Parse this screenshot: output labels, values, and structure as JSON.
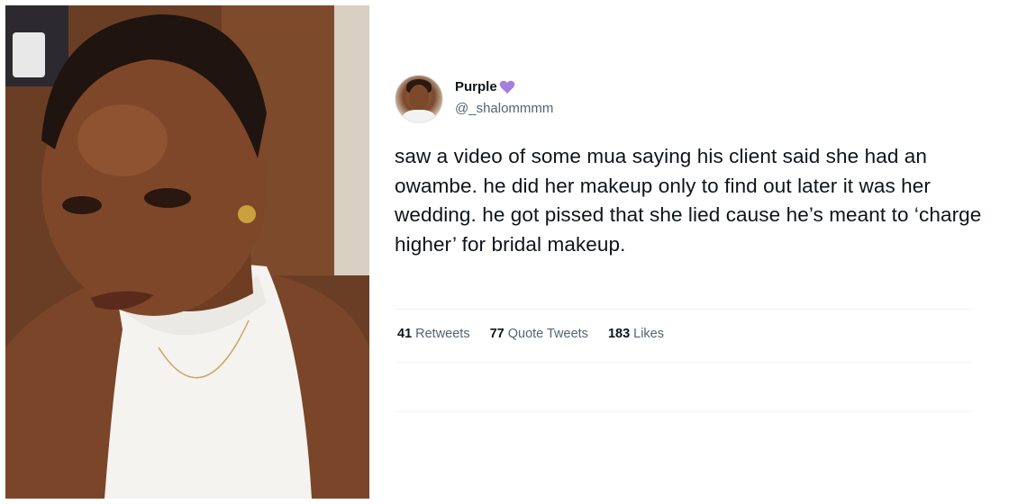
{
  "photo": {
    "alt_subject": "selfie-portrait"
  },
  "tweet": {
    "display_name": "Purple",
    "verified_emoji_icon": "purple-heart-icon",
    "handle": "@_shalommmm",
    "text": "saw a video of some mua saying his client said she had an owambe. he did her makeup only to find out later it was her wedding. he got pissed that she lied cause he’s meant to ‘charge higher’ for bridal makeup.",
    "stats": [
      {
        "count": "41",
        "label": "Retweets"
      },
      {
        "count": "77",
        "label": "Quote Tweets"
      },
      {
        "count": "183",
        "label": "Likes"
      }
    ]
  },
  "colors": {
    "text_primary": "#0f1419",
    "text_secondary": "#536471",
    "heart": "#a47fe0",
    "divider": "#eff3f4"
  }
}
